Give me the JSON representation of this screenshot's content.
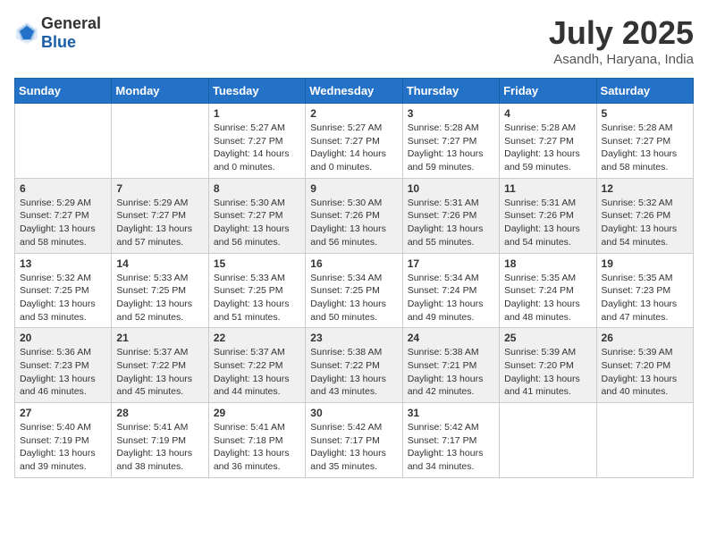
{
  "header": {
    "logo_general": "General",
    "logo_blue": "Blue",
    "month_title": "July 2025",
    "location": "Asandh, Haryana, India"
  },
  "weekdays": [
    "Sunday",
    "Monday",
    "Tuesday",
    "Wednesday",
    "Thursday",
    "Friday",
    "Saturday"
  ],
  "weeks": [
    [
      {
        "day": "",
        "info": ""
      },
      {
        "day": "",
        "info": ""
      },
      {
        "day": "1",
        "info": "Sunrise: 5:27 AM\nSunset: 7:27 PM\nDaylight: 14 hours\nand 0 minutes."
      },
      {
        "day": "2",
        "info": "Sunrise: 5:27 AM\nSunset: 7:27 PM\nDaylight: 14 hours\nand 0 minutes."
      },
      {
        "day": "3",
        "info": "Sunrise: 5:28 AM\nSunset: 7:27 PM\nDaylight: 13 hours\nand 59 minutes."
      },
      {
        "day": "4",
        "info": "Sunrise: 5:28 AM\nSunset: 7:27 PM\nDaylight: 13 hours\nand 59 minutes."
      },
      {
        "day": "5",
        "info": "Sunrise: 5:28 AM\nSunset: 7:27 PM\nDaylight: 13 hours\nand 58 minutes."
      }
    ],
    [
      {
        "day": "6",
        "info": "Sunrise: 5:29 AM\nSunset: 7:27 PM\nDaylight: 13 hours\nand 58 minutes."
      },
      {
        "day": "7",
        "info": "Sunrise: 5:29 AM\nSunset: 7:27 PM\nDaylight: 13 hours\nand 57 minutes."
      },
      {
        "day": "8",
        "info": "Sunrise: 5:30 AM\nSunset: 7:27 PM\nDaylight: 13 hours\nand 56 minutes."
      },
      {
        "day": "9",
        "info": "Sunrise: 5:30 AM\nSunset: 7:26 PM\nDaylight: 13 hours\nand 56 minutes."
      },
      {
        "day": "10",
        "info": "Sunrise: 5:31 AM\nSunset: 7:26 PM\nDaylight: 13 hours\nand 55 minutes."
      },
      {
        "day": "11",
        "info": "Sunrise: 5:31 AM\nSunset: 7:26 PM\nDaylight: 13 hours\nand 54 minutes."
      },
      {
        "day": "12",
        "info": "Sunrise: 5:32 AM\nSunset: 7:26 PM\nDaylight: 13 hours\nand 54 minutes."
      }
    ],
    [
      {
        "day": "13",
        "info": "Sunrise: 5:32 AM\nSunset: 7:25 PM\nDaylight: 13 hours\nand 53 minutes."
      },
      {
        "day": "14",
        "info": "Sunrise: 5:33 AM\nSunset: 7:25 PM\nDaylight: 13 hours\nand 52 minutes."
      },
      {
        "day": "15",
        "info": "Sunrise: 5:33 AM\nSunset: 7:25 PM\nDaylight: 13 hours\nand 51 minutes."
      },
      {
        "day": "16",
        "info": "Sunrise: 5:34 AM\nSunset: 7:25 PM\nDaylight: 13 hours\nand 50 minutes."
      },
      {
        "day": "17",
        "info": "Sunrise: 5:34 AM\nSunset: 7:24 PM\nDaylight: 13 hours\nand 49 minutes."
      },
      {
        "day": "18",
        "info": "Sunrise: 5:35 AM\nSunset: 7:24 PM\nDaylight: 13 hours\nand 48 minutes."
      },
      {
        "day": "19",
        "info": "Sunrise: 5:35 AM\nSunset: 7:23 PM\nDaylight: 13 hours\nand 47 minutes."
      }
    ],
    [
      {
        "day": "20",
        "info": "Sunrise: 5:36 AM\nSunset: 7:23 PM\nDaylight: 13 hours\nand 46 minutes."
      },
      {
        "day": "21",
        "info": "Sunrise: 5:37 AM\nSunset: 7:22 PM\nDaylight: 13 hours\nand 45 minutes."
      },
      {
        "day": "22",
        "info": "Sunrise: 5:37 AM\nSunset: 7:22 PM\nDaylight: 13 hours\nand 44 minutes."
      },
      {
        "day": "23",
        "info": "Sunrise: 5:38 AM\nSunset: 7:22 PM\nDaylight: 13 hours\nand 43 minutes."
      },
      {
        "day": "24",
        "info": "Sunrise: 5:38 AM\nSunset: 7:21 PM\nDaylight: 13 hours\nand 42 minutes."
      },
      {
        "day": "25",
        "info": "Sunrise: 5:39 AM\nSunset: 7:20 PM\nDaylight: 13 hours\nand 41 minutes."
      },
      {
        "day": "26",
        "info": "Sunrise: 5:39 AM\nSunset: 7:20 PM\nDaylight: 13 hours\nand 40 minutes."
      }
    ],
    [
      {
        "day": "27",
        "info": "Sunrise: 5:40 AM\nSunset: 7:19 PM\nDaylight: 13 hours\nand 39 minutes."
      },
      {
        "day": "28",
        "info": "Sunrise: 5:41 AM\nSunset: 7:19 PM\nDaylight: 13 hours\nand 38 minutes."
      },
      {
        "day": "29",
        "info": "Sunrise: 5:41 AM\nSunset: 7:18 PM\nDaylight: 13 hours\nand 36 minutes."
      },
      {
        "day": "30",
        "info": "Sunrise: 5:42 AM\nSunset: 7:17 PM\nDaylight: 13 hours\nand 35 minutes."
      },
      {
        "day": "31",
        "info": "Sunrise: 5:42 AM\nSunset: 7:17 PM\nDaylight: 13 hours\nand 34 minutes."
      },
      {
        "day": "",
        "info": ""
      },
      {
        "day": "",
        "info": ""
      }
    ]
  ]
}
